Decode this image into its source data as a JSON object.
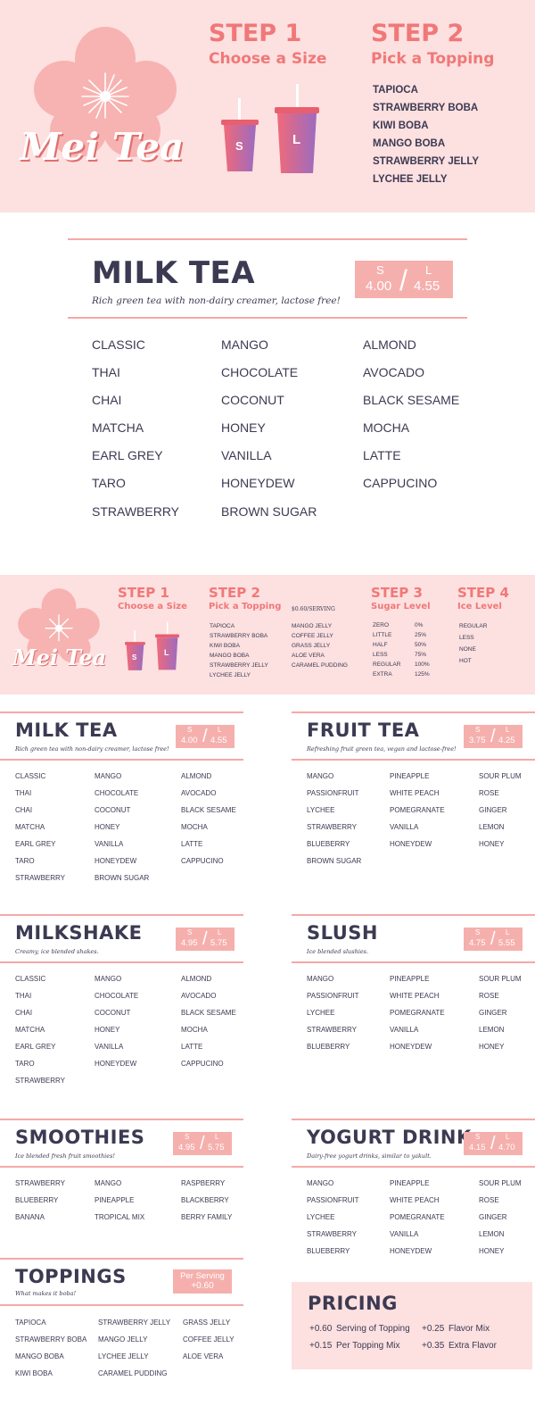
{
  "brand": "Mei Tea",
  "colors": {
    "accent": "#f07878",
    "navy": "#3b3a52",
    "pink_bg": "#fde0e0",
    "badge": "#f5b0ad"
  },
  "banner1": {
    "step1": {
      "title": "STEP 1",
      "subtitle": "Choose a Size"
    },
    "step2": {
      "title": "STEP 2",
      "subtitle": "Pick a Topping"
    },
    "cups": [
      "S",
      "L"
    ],
    "toppings": [
      "TAPIOCA",
      "STRAWBERRY BOBA",
      "KIWI BOBA",
      "MANGO BOBA",
      "STRAWBERRY JELLY",
      "LYCHEE JELLY"
    ]
  },
  "big_milk_tea": {
    "title": "MILK TEA",
    "desc": "Rich green tea with non-dairy creamer, lactose free!",
    "price": {
      "s_label": "S",
      "l_label": "L",
      "s": "4.00",
      "l": "4.55",
      "sep": "/"
    },
    "columns": [
      [
        "CLASSIC",
        "THAI",
        "CHAI",
        "MATCHA",
        "EARL GREY",
        "TARO",
        "STRAWBERRY"
      ],
      [
        "MANGO",
        "CHOCOLATE",
        "COCONUT",
        "HONEY",
        "VANILLA",
        "HONEYDEW",
        "BROWN SUGAR"
      ],
      [
        "ALMOND",
        "AVOCADO",
        "BLACK SESAME",
        "MOCHA",
        "LATTE",
        "CAPPUCINO"
      ]
    ]
  },
  "banner2": {
    "step1": {
      "title": "STEP 1",
      "subtitle": "Choose a Size"
    },
    "step2": {
      "title": "STEP 2",
      "subtitle": "Pick a Topping",
      "note": "$0.60/SERVING"
    },
    "step3": {
      "title": "STEP 3",
      "subtitle": "Sugar Level"
    },
    "step4": {
      "title": "STEP 4",
      "subtitle": "Ice Level"
    },
    "cups": [
      "S",
      "L"
    ],
    "toppings_col1": [
      "TAPIOCA",
      "STRAWBERRY BOBA",
      "KIWI BOBA",
      "MANGO BOBA",
      "STRAWBERRY JELLY",
      "LYCHEE JELLY"
    ],
    "toppings_col2": [
      "MANGO JELLY",
      "COFFEE JELLY",
      "GRASS JELLY",
      "ALOE VERA",
      "CARAMEL PUDDING"
    ],
    "sugar": [
      {
        "name": "ZERO",
        "pct": "0%"
      },
      {
        "name": "LITTLE",
        "pct": "25%"
      },
      {
        "name": "HALF",
        "pct": "50%"
      },
      {
        "name": "LESS",
        "pct": "75%"
      },
      {
        "name": "REGULAR",
        "pct": "100%"
      },
      {
        "name": "EXTRA",
        "pct": "125%"
      }
    ],
    "ice": [
      "REGULAR",
      "LESS",
      "NONE",
      "HOT"
    ]
  },
  "sections": {
    "milk_tea": {
      "title": "MILK TEA",
      "desc": "Rich green tea with non-dairy creamer, lactose free!",
      "price": {
        "s_label": "S",
        "l_label": "L",
        "s": "4.00",
        "l": "4.55",
        "sep": "/"
      },
      "columns": [
        [
          "CLASSIC",
          "THAI",
          "CHAI",
          "MATCHA",
          "EARL GREY",
          "TARO",
          "STRAWBERRY"
        ],
        [
          "MANGO",
          "CHOCOLATE",
          "COCONUT",
          "HONEY",
          "VANILLA",
          "HONEYDEW",
          "BROWN SUGAR"
        ],
        [
          "ALMOND",
          "AVOCADO",
          "BLACK SESAME",
          "MOCHA",
          "LATTE",
          "CAPPUCINO"
        ]
      ]
    },
    "fruit_tea": {
      "title": "FRUIT TEA",
      "desc": "Refreshing fruit green tea, vegan and lactose-free!",
      "price": {
        "s_label": "S",
        "l_label": "L",
        "s": "3.75",
        "l": "4.25",
        "sep": "/"
      },
      "columns": [
        [
          "MANGO",
          "PASSIONFRUIT",
          "LYCHEE",
          "STRAWBERRY",
          "BLUEBERRY",
          "BROWN SUGAR"
        ],
        [
          "PINEAPPLE",
          "WHITE PEACH",
          "POMEGRANATE",
          "VANILLA",
          "HONEYDEW"
        ],
        [
          "SOUR PLUM",
          "ROSE",
          "GINGER",
          "LEMON",
          "HONEY"
        ]
      ]
    },
    "milkshake": {
      "title": "MILKSHAKE",
      "desc": "Creamy, ice blended shakes.",
      "price": {
        "s_label": "S",
        "l_label": "L",
        "s": "4.95",
        "l": "5.75",
        "sep": "/"
      },
      "columns": [
        [
          "CLASSIC",
          "THAI",
          "CHAI",
          "MATCHA",
          "EARL GREY",
          "TARO",
          "STRAWBERRY"
        ],
        [
          "MANGO",
          "CHOCOLATE",
          "COCONUT",
          "HONEY",
          "VANILLA",
          "HONEYDEW"
        ],
        [
          "ALMOND",
          "AVOCADO",
          "BLACK SESAME",
          "MOCHA",
          "LATTE",
          "CAPPUCINO"
        ]
      ]
    },
    "slush": {
      "title": "SLUSH",
      "desc": "Ice blended slushies.",
      "price": {
        "s_label": "S",
        "l_label": "L",
        "s": "4.75",
        "l": "5.55",
        "sep": "/"
      },
      "columns": [
        [
          "MANGO",
          "PASSIONFRUIT",
          "LYCHEE",
          "STRAWBERRY",
          "BLUEBERRY"
        ],
        [
          "PINEAPPLE",
          "WHITE PEACH",
          "POMEGRANATE",
          "VANILLA",
          "HONEYDEW"
        ],
        [
          "SOUR PLUM",
          "ROSE",
          "GINGER",
          "LEMON",
          "HONEY"
        ]
      ]
    },
    "smoothies": {
      "title": "SMOOTHIES",
      "desc": "Ice blended fresh fruit smoothies!",
      "price": {
        "s_label": "S",
        "l_label": "L",
        "s": "4.95",
        "l": "5.75",
        "sep": "/"
      },
      "columns": [
        [
          "STRAWBERRY",
          "BLUEBERRY",
          "BANANA"
        ],
        [
          "MANGO",
          "PINEAPPLE",
          "TROPICAL MIX"
        ],
        [
          "RASPBERRY",
          "BLACKBERRY",
          "BERRY FAMILY"
        ]
      ]
    },
    "yogurt_drink": {
      "title": "YOGURT DRINK",
      "desc": "Dairy-free yogurt drinks, similar to yakult.",
      "price": {
        "s_label": "S",
        "l_label": "L",
        "s": "4.15",
        "l": "4.70",
        "sep": "/"
      },
      "columns": [
        [
          "MANGO",
          "PASSIONFRUIT",
          "LYCHEE",
          "STRAWBERRY",
          "BLUEBERRY"
        ],
        [
          "PINEAPPLE",
          "WHITE PEACH",
          "POMEGRANATE",
          "VANILLA",
          "HONEYDEW"
        ],
        [
          "SOUR PLUM",
          "ROSE",
          "GINGER",
          "LEMON",
          "HONEY"
        ]
      ]
    },
    "toppings": {
      "title": "TOPPINGS",
      "desc": "What makes it boba!",
      "price_label": "Per Serving",
      "price_value": "+0.60",
      "columns": [
        [
          "TAPIOCA",
          "STRAWBERRY BOBA",
          "MANGO BOBA",
          "KIWI BOBA"
        ],
        [
          "STRAWBERRY JELLY",
          "MANGO JELLY",
          "LYCHEE JELLY",
          "CARAMEL PUDDING"
        ],
        [
          "GRASS JELLY",
          "COFFEE JELLY",
          "ALOE VERA"
        ]
      ]
    }
  },
  "pricing": {
    "title": "PRICING",
    "rows": [
      {
        "price": "+0.60",
        "label": "Serving of Topping"
      },
      {
        "price": "+0.25",
        "label": "Flavor Mix"
      },
      {
        "price": "+0.15",
        "label": "Per Topping Mix"
      },
      {
        "price": "+0.35",
        "label": "Extra Flavor"
      }
    ]
  }
}
